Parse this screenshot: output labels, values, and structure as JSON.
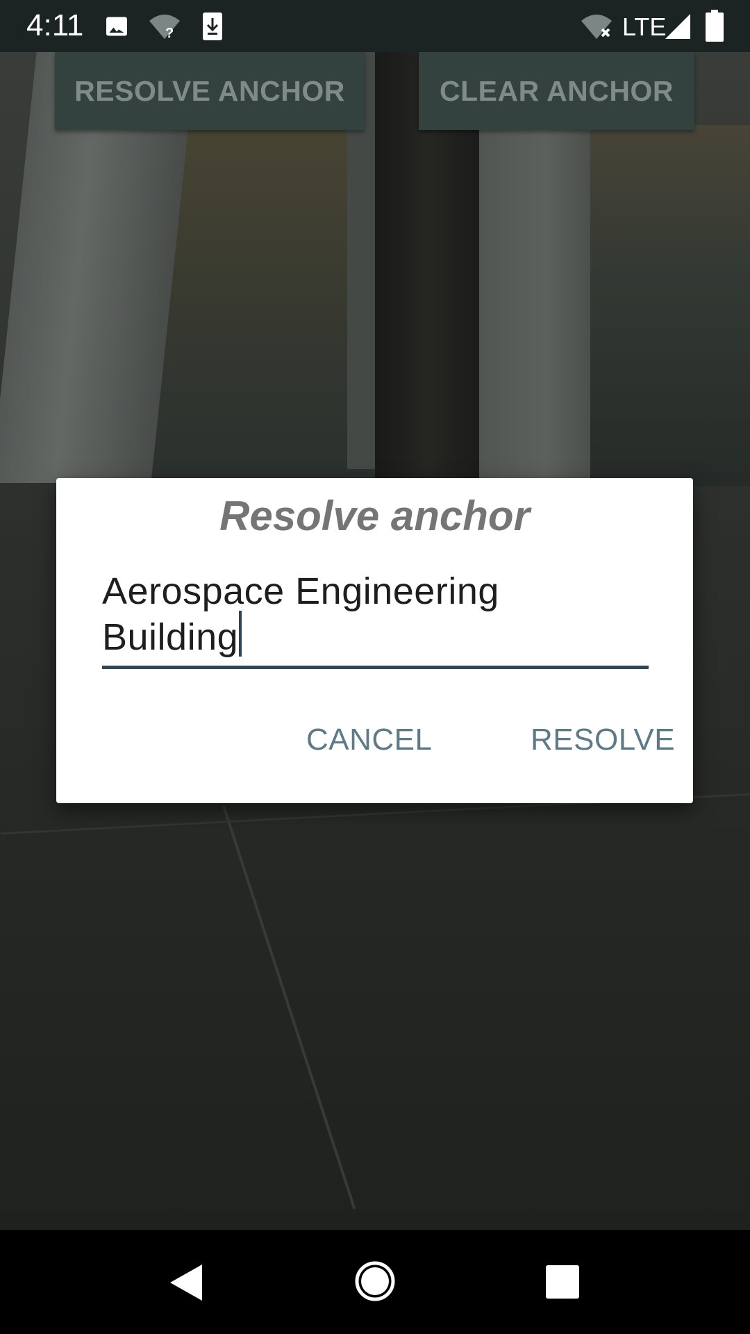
{
  "status_bar": {
    "time": "4:11",
    "network": "LTE",
    "icons": [
      "image-icon",
      "wifi-question-icon",
      "download-icon",
      "wifi-off-icon",
      "signal-icon",
      "battery-icon"
    ]
  },
  "top_buttons": {
    "resolve_anchor": "RESOLVE ANCHOR",
    "clear_anchor": "CLEAR ANCHOR"
  },
  "dialog": {
    "title": "Resolve anchor",
    "input_value": "Aerospace Engineering\nBuilding",
    "cancel_label": "CANCEL",
    "resolve_label": "RESOLVE"
  },
  "nav_bar": {
    "icons": [
      "back-icon",
      "home-icon",
      "recents-icon"
    ]
  },
  "colors": {
    "accent": "#5f7a85",
    "input_underline": "#2d4651",
    "top_button_bg": "#33413f",
    "status_bar_bg": "#1c2323"
  }
}
